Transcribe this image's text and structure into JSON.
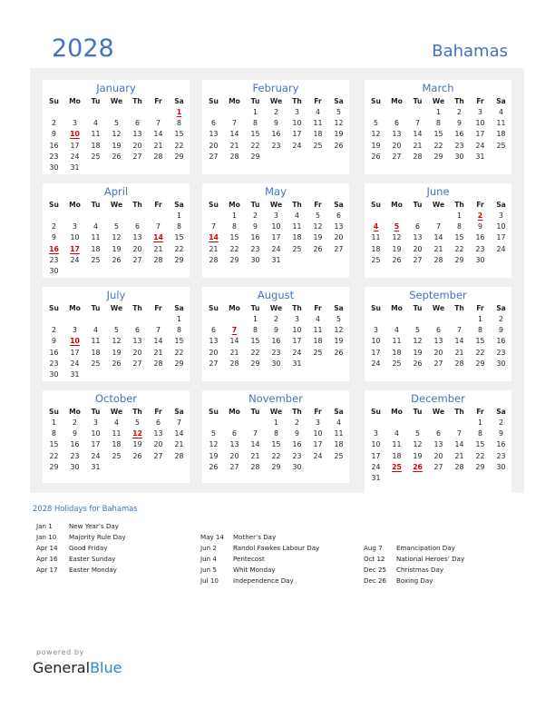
{
  "header": {
    "year": "2028",
    "country": "Bahamas"
  },
  "weekdays": [
    "Su",
    "Mo",
    "Tu",
    "We",
    "Th",
    "Fr",
    "Sa"
  ],
  "months": [
    {
      "name": "January",
      "start": 6,
      "days": 31,
      "holidays": [
        1,
        10
      ]
    },
    {
      "name": "February",
      "start": 2,
      "days": 29,
      "holidays": []
    },
    {
      "name": "March",
      "start": 3,
      "days": 31,
      "holidays": []
    },
    {
      "name": "April",
      "start": 6,
      "days": 30,
      "holidays": [
        14,
        16,
        17
      ]
    },
    {
      "name": "May",
      "start": 1,
      "days": 31,
      "holidays": [
        14
      ]
    },
    {
      "name": "June",
      "start": 4,
      "days": 30,
      "holidays": [
        2,
        4,
        5
      ]
    },
    {
      "name": "July",
      "start": 6,
      "days": 31,
      "holidays": [
        10
      ]
    },
    {
      "name": "August",
      "start": 2,
      "days": 31,
      "holidays": [
        7
      ]
    },
    {
      "name": "September",
      "start": 5,
      "days": 30,
      "holidays": []
    },
    {
      "name": "October",
      "start": 0,
      "days": 31,
      "holidays": [
        12
      ]
    },
    {
      "name": "November",
      "start": 3,
      "days": 30,
      "holidays": []
    },
    {
      "name": "December",
      "start": 5,
      "days": 31,
      "holidays": [
        25,
        26
      ]
    }
  ],
  "holidays_title": "2028 Holidays for Bahamas",
  "holiday_columns": [
    [
      {
        "date": "Jan 1",
        "name": "New Year’s Day"
      },
      {
        "date": "Jan 10",
        "name": "Majority Rule Day"
      },
      {
        "date": "Apr 14",
        "name": "Good Friday"
      },
      {
        "date": "Apr 16",
        "name": "Easter Sunday"
      },
      {
        "date": "Apr 17",
        "name": "Easter Monday"
      }
    ],
    [
      {
        "date": "May 14",
        "name": "Mother’s Day"
      },
      {
        "date": "Jun 2",
        "name": "Randol Fawkes Labour Day"
      },
      {
        "date": "Jun 4",
        "name": "Pentecost"
      },
      {
        "date": "Jun 5",
        "name": "Whit Monday"
      },
      {
        "date": "Jul 10",
        "name": "Independence Day"
      }
    ],
    [
      {
        "date": "Aug 7",
        "name": "Emancipation Day"
      },
      {
        "date": "Oct 12",
        "name": "National Heroes’ Day"
      },
      {
        "date": "Dec 25",
        "name": "Christmas Day"
      },
      {
        "date": "Dec 26",
        "name": "Boxing Day"
      }
    ]
  ],
  "footer": {
    "powered_by": "powered by",
    "brand_general": "General",
    "brand_blue": "Blue"
  }
}
